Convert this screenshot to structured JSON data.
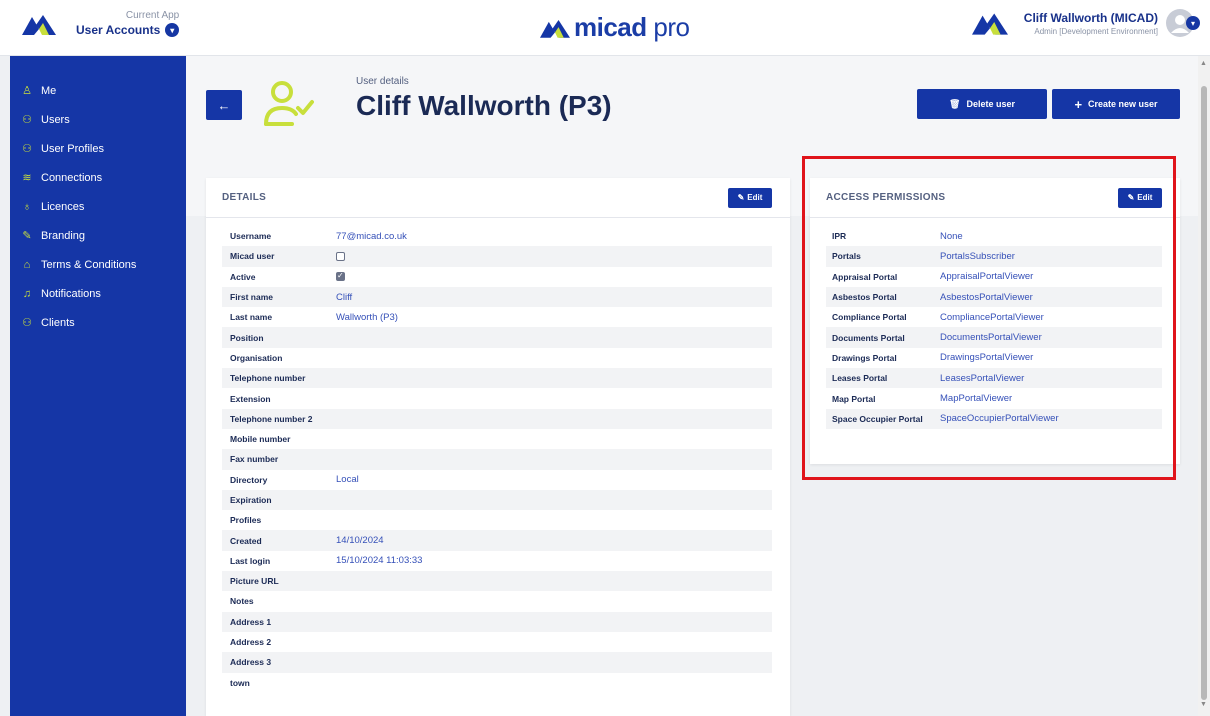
{
  "topbar": {
    "current_app_caption": "Current App",
    "current_app_name": "User Accounts",
    "brand_bold": "micad",
    "brand_light": " pro",
    "user_name": "Cliff Wallworth (MICAD)",
    "user_role": "Admin [Development Environment]"
  },
  "sidebar": {
    "items": [
      {
        "label": "Me",
        "icon": "user-icon"
      },
      {
        "label": "Users",
        "icon": "users-icon"
      },
      {
        "label": "User Profiles",
        "icon": "user-profiles-icon"
      },
      {
        "label": "Connections",
        "icon": "wifi-icon"
      },
      {
        "label": "Licences",
        "icon": "ribbon-icon"
      },
      {
        "label": "Branding",
        "icon": "pen-icon"
      },
      {
        "label": "Terms & Conditions",
        "icon": "bag-icon"
      },
      {
        "label": "Notifications",
        "icon": "bell-icon"
      },
      {
        "label": "Clients",
        "icon": "clients-icon"
      }
    ]
  },
  "header": {
    "subtitle": "User details",
    "title": "Cliff Wallworth (P3)",
    "delete_label": "Delete user",
    "create_label": "Create new user"
  },
  "details": {
    "title": "DETAILS",
    "edit_label": "Edit",
    "rows": [
      {
        "label": "Username",
        "value": "77@micad.co.uk"
      },
      {
        "label": "Micad user",
        "value": ""
      },
      {
        "label": "Active",
        "value": ""
      },
      {
        "label": "First name",
        "value": "Cliff"
      },
      {
        "label": "Last name",
        "value": "Wallworth (P3)"
      },
      {
        "label": "Position",
        "value": ""
      },
      {
        "label": "Organisation",
        "value": ""
      },
      {
        "label": "Telephone number",
        "value": ""
      },
      {
        "label": "Extension",
        "value": ""
      },
      {
        "label": "Telephone number 2",
        "value": ""
      },
      {
        "label": "Mobile number",
        "value": ""
      },
      {
        "label": "Fax number",
        "value": ""
      },
      {
        "label": "Directory",
        "value": "Local"
      },
      {
        "label": "Expiration",
        "value": ""
      },
      {
        "label": "Profiles",
        "value": ""
      },
      {
        "label": "Created",
        "value": "14/10/2024"
      },
      {
        "label": "Last login",
        "value": "15/10/2024 11:03:33"
      },
      {
        "label": "Picture URL",
        "value": ""
      },
      {
        "label": "Notes",
        "value": ""
      },
      {
        "label": "Address 1",
        "value": ""
      },
      {
        "label": "Address 2",
        "value": ""
      },
      {
        "label": "Address 3",
        "value": ""
      },
      {
        "label": "town",
        "value": ""
      }
    ],
    "micad_user_checked": false,
    "active_checked": true
  },
  "access": {
    "title": "ACCESS PERMISSIONS",
    "edit_label": "Edit",
    "rows": [
      {
        "label": "IPR",
        "value": "None"
      },
      {
        "label": "Portals",
        "value": "PortalsSubscriber"
      },
      {
        "label": "Appraisal Portal",
        "value": "AppraisalPortalViewer"
      },
      {
        "label": "Asbestos Portal",
        "value": "AsbestosPortalViewer"
      },
      {
        "label": "Compliance Portal",
        "value": "CompliancePortalViewer"
      },
      {
        "label": "Documents Portal",
        "value": "DocumentsPortalViewer"
      },
      {
        "label": "Drawings Portal",
        "value": "DrawingsPortalViewer"
      },
      {
        "label": "Leases Portal",
        "value": "LeasesPortalViewer"
      },
      {
        "label": "Map Portal",
        "value": "MapPortalViewer"
      },
      {
        "label": "Space Occupier Portal",
        "value": "SpaceOccupierPortalViewer"
      }
    ]
  },
  "colors": {
    "primary": "#1536a6",
    "accent": "#c8df3c",
    "highlight": "#e0141b"
  }
}
